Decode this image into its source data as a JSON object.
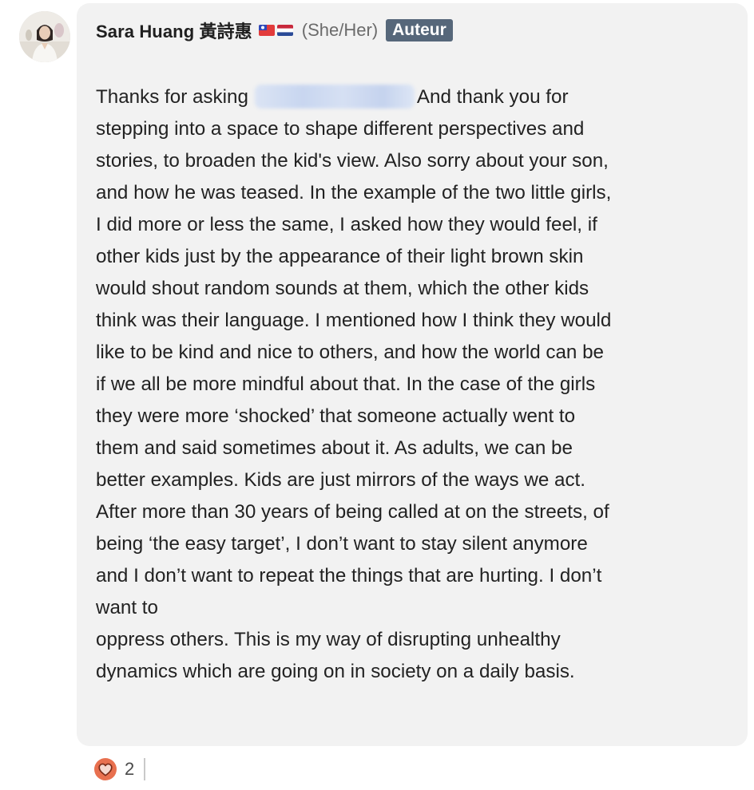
{
  "author": {
    "name": "Sara Huang 黃詩惠",
    "flags": [
      "taiwan-flag-icon",
      "netherlands-flag-icon"
    ],
    "pronouns": "(She/Her)",
    "badge": "Auteur"
  },
  "comment": {
    "line_0_before": "Thanks for asking",
    "line_0_after": "And thank you for",
    "lines": [
      "stepping into a space to shape different perspectives and",
      "stories, to broaden the kid's view. Also sorry about your son,",
      "and how he was teased. In the example of the two little girls,",
      "I did more or less the same, I asked how they would feel, if",
      "other kids just by the appearance of their light brown skin",
      "would shout random sounds at them, which the other kids",
      "think was their language. I mentioned how I think they would",
      "like to be kind and nice to others,  and how the world can be",
      "if we all be more mindful about that. In the case of the girls",
      "they were more ‘shocked’ that someone actually went to",
      "them and said sometimes about it. As adults, we can be",
      "better examples. Kids are just mirrors of the ways we act.",
      "After more than 30 years of being called at on the streets, of",
      "being ‘the easy target’, I don’t want to stay silent anymore",
      "and I don’t want to repeat the things that are hurting. I don’t",
      "want to",
      "oppress others. This is my way of disrupting unhealthy",
      "dynamics which are going on in society on a daily basis."
    ]
  },
  "reactions": {
    "icon": "heart-icon",
    "count": "2"
  },
  "colors": {
    "bubble_bg": "#f2f2f2",
    "badge_bg": "#56677a",
    "heart": "#e8704f",
    "text": "#222222",
    "muted": "#6b6b6b"
  }
}
